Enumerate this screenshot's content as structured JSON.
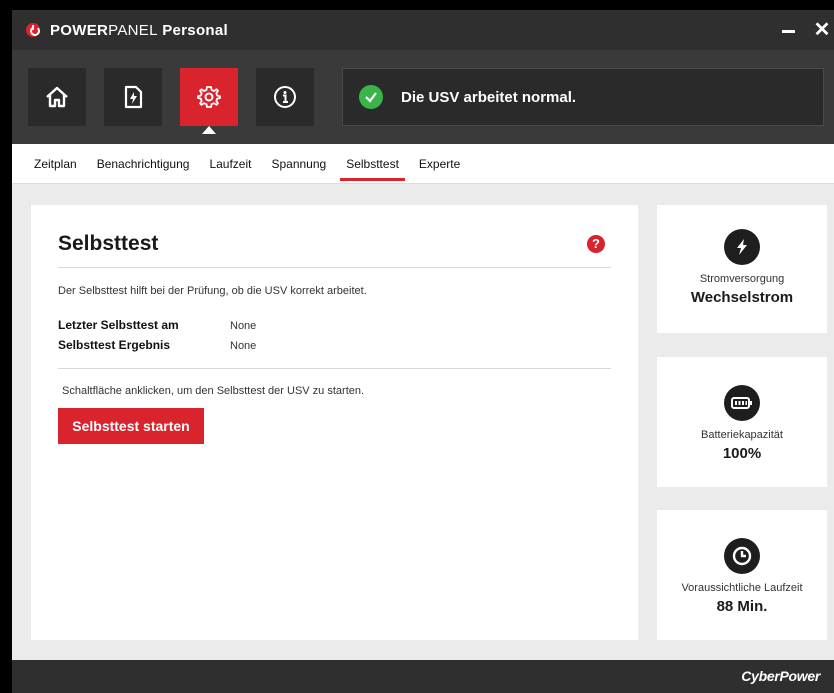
{
  "app": {
    "title_part1": "POWER",
    "title_part2": "PANEL",
    "title_part3": " Personal",
    "close_label": "✕"
  },
  "toolbar": {
    "buttons": [
      {
        "icon": "home-icon"
      },
      {
        "icon": "power-file-icon"
      },
      {
        "icon": "gear-icon",
        "active": true
      },
      {
        "icon": "info-icon"
      }
    ],
    "status_text": "Die USV arbeitet normal.",
    "status_color": "#3ab54a"
  },
  "tabs": [
    {
      "label": "Zeitplan"
    },
    {
      "label": "Benachrichtigung"
    },
    {
      "label": "Laufzeit"
    },
    {
      "label": "Spannung"
    },
    {
      "label": "Selbsttest",
      "active": true
    },
    {
      "label": "Experte"
    }
  ],
  "main": {
    "title": "Selbsttest",
    "help": "?",
    "description": "Der Selbsttest hilft bei der Prüfung, ob die USV korrekt arbeitet.",
    "last_test_label": "Letzter Selbsttest am",
    "last_test_value": "None",
    "result_label": "Selbsttest Ergebnis",
    "result_value": "None",
    "hint": "Schaltfläche anklicken, um den Selbsttest der USV zu starten.",
    "start_button": "Selbsttest starten"
  },
  "side": {
    "power": {
      "label": "Stromversorgung",
      "value": "Wechselstrom",
      "icon": "lightning-icon"
    },
    "battery": {
      "label": "Batteriekapazität",
      "value": "100%",
      "icon": "battery-icon"
    },
    "runtime": {
      "label": "Voraussichtliche Laufzeit",
      "value": "88 Min.",
      "icon": "clock-icon"
    }
  },
  "footer": {
    "brand": "CyberPower"
  },
  "colors": {
    "accent": "#d9232d",
    "dark": "#2f2f2f"
  }
}
